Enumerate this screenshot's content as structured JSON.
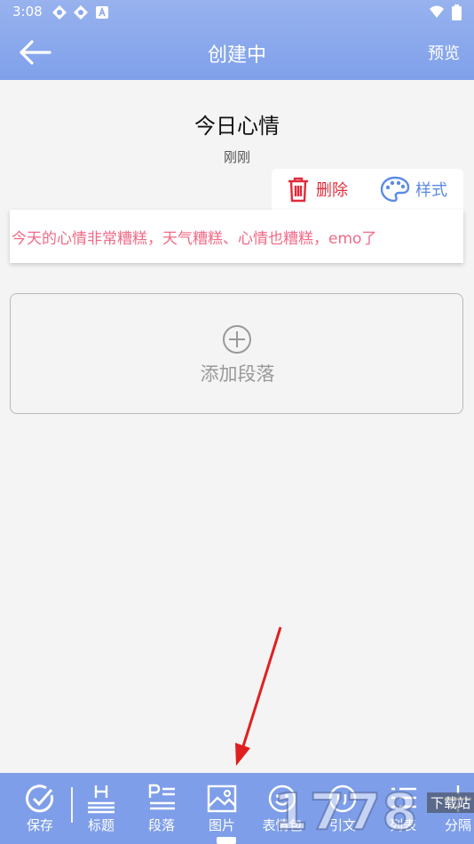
{
  "status_bar": {
    "time": "3:08"
  },
  "appbar": {
    "title": "创建中",
    "preview_label": "预览"
  },
  "document": {
    "title": "今日心情",
    "timestamp": "刚刚"
  },
  "paragraph_actions": {
    "delete_label": "删除",
    "style_label": "样式"
  },
  "paragraph": {
    "text": "今天的心情非常糟糕，天气糟糕、心情也糟糕，emo了"
  },
  "add_paragraph": {
    "label": "添加段落"
  },
  "toolbar": {
    "save_label": "保存",
    "heading_label": "标题",
    "paragraph_label": "段落",
    "image_label": "图片",
    "emoji_label": "表情包",
    "quote_label": "引文",
    "list_label": "列表",
    "divider_label": "分隔"
  },
  "watermark": {
    "text": "1778",
    "suffix": "下载站"
  },
  "colors": {
    "header": "#8aa8ec",
    "toolbar": "#7e9ee9",
    "delete": "#e02c3c",
    "accent": "#5b8be4",
    "paragraph_text": "#f06a86"
  }
}
